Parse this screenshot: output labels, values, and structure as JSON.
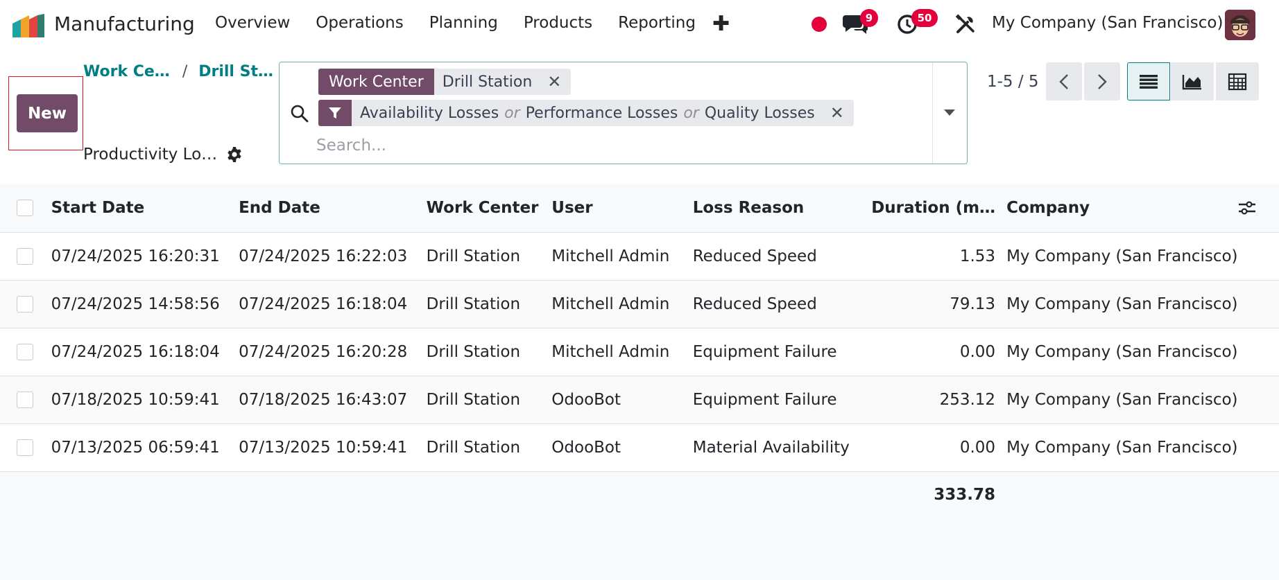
{
  "app": {
    "name": "Manufacturing",
    "menu": [
      "Overview",
      "Operations",
      "Planning",
      "Products",
      "Reporting"
    ],
    "messages_count": "9",
    "activities_count": "50",
    "company": "My Company (San Francisco)",
    "brand_color": "#714b67",
    "accent_color": "#017e84",
    "badge_color": "#e4003b"
  },
  "control_panel": {
    "new_label": "New",
    "breadcrumb": [
      "Work Ce…",
      "Drill St…"
    ],
    "breadcrumb_separator": "/",
    "page_title": "Productivity Lo…"
  },
  "search": {
    "facets": [
      {
        "label": "Work Center",
        "values": [
          "Drill Station"
        ]
      },
      {
        "icon": "filter-icon",
        "values": [
          "Availability Losses",
          "Performance Losses",
          "Quality Losses"
        ]
      }
    ],
    "or_text": "or",
    "placeholder": "Search..."
  },
  "pager": {
    "value": "1-5 / 5"
  },
  "views": [
    "list-view-icon",
    "graph-view-icon",
    "pivot-view-icon"
  ],
  "table": {
    "columns": [
      "Start Date",
      "End Date",
      "Work Center",
      "User",
      "Loss Reason",
      "Duration (m…",
      "Company"
    ],
    "rows": [
      [
        "07/24/2025 16:20:31",
        "07/24/2025 16:22:03",
        "Drill Station",
        "Mitchell Admin",
        "Reduced Speed",
        "1.53",
        "My Company (San Francisco)"
      ],
      [
        "07/24/2025 14:58:56",
        "07/24/2025 16:18:04",
        "Drill Station",
        "Mitchell Admin",
        "Reduced Speed",
        "79.13",
        "My Company (San Francisco)"
      ],
      [
        "07/24/2025 16:18:04",
        "07/24/2025 16:20:28",
        "Drill Station",
        "Mitchell Admin",
        "Equipment Failure",
        "0.00",
        "My Company (San Francisco)"
      ],
      [
        "07/18/2025 10:59:41",
        "07/18/2025 16:43:07",
        "Drill Station",
        "OdooBot",
        "Equipment Failure",
        "253.12",
        "My Company (San Francisco)"
      ],
      [
        "07/13/2025 06:59:41",
        "07/13/2025 10:59:41",
        "Drill Station",
        "OdooBot",
        "Material Availability",
        "0.00",
        "My Company (San Francisco)"
      ]
    ],
    "total_duration": "333.78"
  }
}
